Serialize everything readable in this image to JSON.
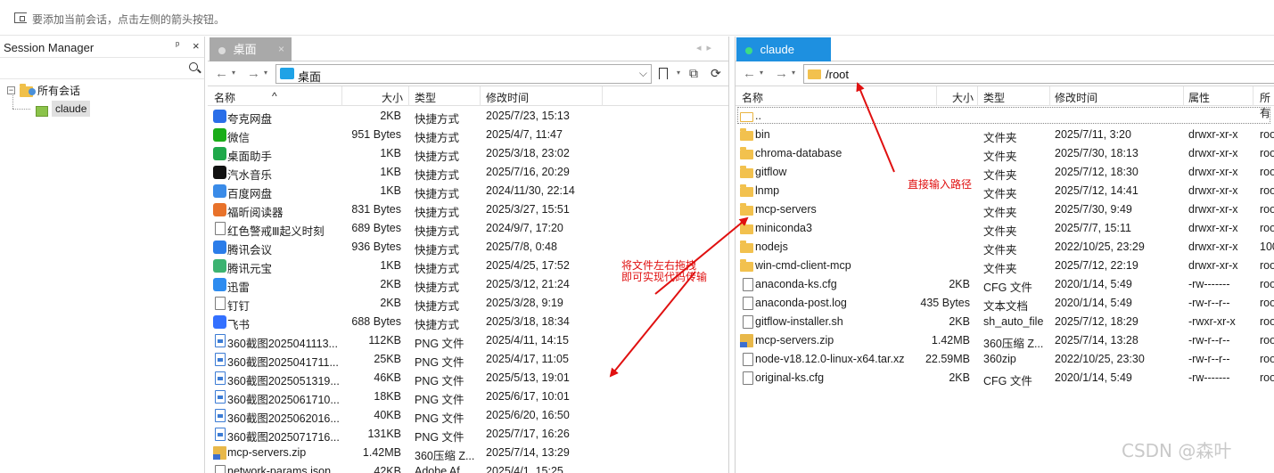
{
  "hint": {
    "text": "要添加当前会话，点击左侧的箭头按钮。"
  },
  "session_manager": {
    "title": "Session Manager",
    "pin": "ᵖ",
    "close": "×",
    "tree": [
      {
        "label": "所有会话"
      },
      {
        "label": "claude"
      }
    ]
  },
  "left_panel": {
    "tab": {
      "label": "桌面",
      "close": "×"
    },
    "nav": {
      "back": "←",
      "forward": "→",
      "caret": "▾"
    },
    "path": "桌面",
    "tools": {
      "bookmark": "🔖",
      "caret": "▾",
      "sync": "⧉",
      "refresh": "⟳",
      "dropdown": "⌵"
    },
    "columns": {
      "name": "名称",
      "size": "大小",
      "type": "类型",
      "mtime": "修改时间"
    },
    "rows": [
      {
        "name": "夸克网盘",
        "size": "2KB",
        "type": "快捷方式",
        "mtime": "2025/7/23, 15:13",
        "icon": "app-icon",
        "color": "#2a6ee8"
      },
      {
        "name": "微信",
        "size": "951 Bytes",
        "type": "快捷方式",
        "mtime": "2025/4/7, 11:47",
        "icon": "app-icon",
        "color": "#1aad19"
      },
      {
        "name": "桌面助手",
        "size": "1KB",
        "type": "快捷方式",
        "mtime": "2025/3/18, 23:02",
        "icon": "app-icon",
        "color": "#1fa84a"
      },
      {
        "name": "汽水音乐",
        "size": "1KB",
        "type": "快捷方式",
        "mtime": "2025/7/16, 20:29",
        "icon": "app-icon",
        "color": "#111111"
      },
      {
        "name": "百度网盘",
        "size": "1KB",
        "type": "快捷方式",
        "mtime": "2024/11/30, 22:14",
        "icon": "app-icon",
        "color": "#3a8be8"
      },
      {
        "name": "福昕阅读器",
        "size": "831 Bytes",
        "type": "快捷方式",
        "mtime": "2025/3/27, 15:51",
        "icon": "app-icon",
        "color": "#e8722a"
      },
      {
        "name": "红色警戒Ⅲ起义时刻",
        "size": "689 Bytes",
        "type": "快捷方式",
        "mtime": "2024/9/7, 17:20",
        "icon": "file-icon",
        "color": "#888888"
      },
      {
        "name": "腾讯会议",
        "size": "936 Bytes",
        "type": "快捷方式",
        "mtime": "2025/7/8, 0:48",
        "icon": "app-icon",
        "color": "#2b7de9"
      },
      {
        "name": "腾讯元宝",
        "size": "1KB",
        "type": "快捷方式",
        "mtime": "2025/4/25, 17:52",
        "icon": "app-icon",
        "color": "#3cb371"
      },
      {
        "name": "迅雷",
        "size": "2KB",
        "type": "快捷方式",
        "mtime": "2025/3/12, 21:24",
        "icon": "app-icon",
        "color": "#2d8cf0"
      },
      {
        "name": "钉钉",
        "size": "2KB",
        "type": "快捷方式",
        "mtime": "2025/3/28, 9:19",
        "icon": "file-icon",
        "color": "#888888"
      },
      {
        "name": "飞书",
        "size": "688 Bytes",
        "type": "快捷方式",
        "mtime": "2025/3/18, 18:34",
        "icon": "app-icon",
        "color": "#3370ff"
      },
      {
        "name": "360截图2025041113...",
        "size": "112KB",
        "type": "PNG 文件",
        "mtime": "2025/4/11, 14:15",
        "icon": "png-icon"
      },
      {
        "name": "360截图2025041711...",
        "size": "25KB",
        "type": "PNG 文件",
        "mtime": "2025/4/17, 11:05",
        "icon": "png-icon"
      },
      {
        "name": "360截图2025051319...",
        "size": "46KB",
        "type": "PNG 文件",
        "mtime": "2025/5/13, 19:01",
        "icon": "png-icon"
      },
      {
        "name": "360截图2025061710...",
        "size": "18KB",
        "type": "PNG 文件",
        "mtime": "2025/6/17, 10:01",
        "icon": "png-icon"
      },
      {
        "name": "360截图2025062016...",
        "size": "40KB",
        "type": "PNG 文件",
        "mtime": "2025/6/20, 16:50",
        "icon": "png-icon"
      },
      {
        "name": "360截图2025071716...",
        "size": "131KB",
        "type": "PNG 文件",
        "mtime": "2025/7/17, 16:26",
        "icon": "png-icon"
      },
      {
        "name": "mcp-servers.zip",
        "size": "1.42MB",
        "type": "360压缩 Z...",
        "mtime": "2025/7/14, 13:29",
        "icon": "zip-icon"
      },
      {
        "name": "network-params.json",
        "size": "42KB",
        "type": "Adobe Af...",
        "mtime": "2025/4/1, 15:25",
        "icon": "file-icon"
      }
    ]
  },
  "right_panel": {
    "tab": {
      "label": "claude",
      "status_color": "#3ddc84"
    },
    "nav": {
      "back": "←",
      "forward": "→",
      "caret": "▾"
    },
    "path": "/root",
    "columns": {
      "name": "名称",
      "size": "大小",
      "type": "类型",
      "mtime": "修改时间",
      "attr": "属性",
      "owner": "所有"
    },
    "rows": [
      {
        "name": "..",
        "size": "",
        "type": "",
        "mtime": "",
        "attr": "",
        "owner": "",
        "icon": "folder-up-icon"
      },
      {
        "name": "bin",
        "size": "",
        "type": "文件夹",
        "mtime": "2025/7/11, 3:20",
        "attr": "drwxr-xr-x",
        "owner": "roo",
        "icon": "folder-icon"
      },
      {
        "name": "chroma-database",
        "size": "",
        "type": "文件夹",
        "mtime": "2025/7/30, 18:13",
        "attr": "drwxr-xr-x",
        "owner": "roo",
        "icon": "folder-icon"
      },
      {
        "name": "gitflow",
        "size": "",
        "type": "文件夹",
        "mtime": "2025/7/12, 18:30",
        "attr": "drwxr-xr-x",
        "owner": "roo",
        "icon": "folder-icon"
      },
      {
        "name": "lnmp",
        "size": "",
        "type": "文件夹",
        "mtime": "2025/7/12, 14:41",
        "attr": "drwxr-xr-x",
        "owner": "roo",
        "icon": "folder-icon"
      },
      {
        "name": "mcp-servers",
        "size": "",
        "type": "文件夹",
        "mtime": "2025/7/30, 9:49",
        "attr": "drwxr-xr-x",
        "owner": "roo",
        "icon": "folder-icon"
      },
      {
        "name": "miniconda3",
        "size": "",
        "type": "文件夹",
        "mtime": "2025/7/7, 15:11",
        "attr": "drwxr-xr-x",
        "owner": "roo",
        "icon": "folder-icon"
      },
      {
        "name": "nodejs",
        "size": "",
        "type": "文件夹",
        "mtime": "2022/10/25, 23:29",
        "attr": "drwxr-xr-x",
        "owner": "100",
        "icon": "folder-icon"
      },
      {
        "name": "win-cmd-client-mcp",
        "size": "",
        "type": "文件夹",
        "mtime": "2025/7/12, 22:19",
        "attr": "drwxr-xr-x",
        "owner": "roo",
        "icon": "folder-icon"
      },
      {
        "name": "anaconda-ks.cfg",
        "size": "2KB",
        "type": "CFG 文件",
        "mtime": "2020/1/14, 5:49",
        "attr": "-rw-------",
        "owner": "roo",
        "icon": "file-icon"
      },
      {
        "name": "anaconda-post.log",
        "size": "435 Bytes",
        "type": "文本文档",
        "mtime": "2020/1/14, 5:49",
        "attr": "-rw-r--r--",
        "owner": "roo",
        "icon": "file-icon"
      },
      {
        "name": "gitflow-installer.sh",
        "size": "2KB",
        "type": "sh_auto_file",
        "mtime": "2025/7/12, 18:29",
        "attr": "-rwxr-xr-x",
        "owner": "roo",
        "icon": "file-icon"
      },
      {
        "name": "mcp-servers.zip",
        "size": "1.42MB",
        "type": "360压缩 Z...",
        "mtime": "2025/7/14, 13:28",
        "attr": "-rw-r--r--",
        "owner": "roo",
        "icon": "zip-icon"
      },
      {
        "name": "node-v18.12.0-linux-x64.tar.xz",
        "size": "22.59MB",
        "type": "360zip",
        "mtime": "2022/10/25, 23:30",
        "attr": "-rw-r--r--",
        "owner": "roo",
        "icon": "file-icon"
      },
      {
        "name": "original-ks.cfg",
        "size": "2KB",
        "type": "CFG 文件",
        "mtime": "2020/1/14, 5:49",
        "attr": "-rw-------",
        "owner": "roo",
        "icon": "file-icon"
      }
    ]
  },
  "annotations": {
    "path_hint": "直接输入路径",
    "drag_hint_line1": "将文件左右拖拽",
    "drag_hint_line2": "即可实现代码传输",
    "color": "#e01010"
  },
  "watermark": "CSDN @森叶"
}
